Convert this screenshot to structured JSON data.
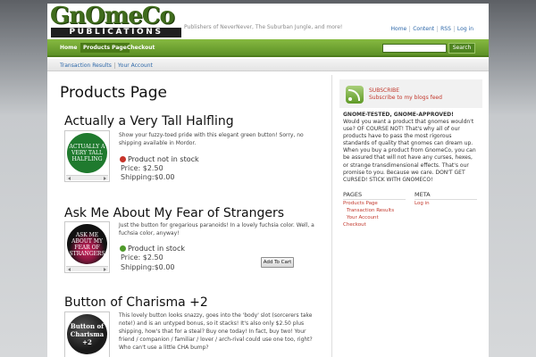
{
  "header": {
    "logo_text": "GnOmeCo",
    "logo_subtext": "PUBLICATIONS",
    "tagline": "Publishers of NeverNever, The Suburban Jungle, and more!",
    "links": [
      "Home",
      "Content",
      "RSS",
      "Log in"
    ]
  },
  "nav": {
    "items": [
      "Home",
      "Products Page",
      "Checkout"
    ],
    "active": "Products Page",
    "search_button": "Search",
    "search_value": ""
  },
  "subnav": {
    "items": [
      "Transaction Results",
      "Your Account"
    ]
  },
  "main": {
    "title": "Products Page",
    "products": [
      {
        "title": "Actually a Very Tall Halfling",
        "image_text": "ACTUALLY A VERY TALL HALFLING",
        "image_color": "#1f7a2e",
        "description": "Show your fuzzy-toed pride with this elegant green button! Sorry, no shipping available in Mordor.",
        "stock": "Product not in stock",
        "price": "Price: $2.50",
        "shipping": "Shipping:$0.00"
      },
      {
        "title": "Ask Me About My Fear of Strangers",
        "image_text": "ASK ME ABOUT MY FEAR OF STRANGERS",
        "image_color": "#111111",
        "description": "Just the button for gregarious paranoids! In a lovely fuchsia color. Well, a fuchsia color, anyway!",
        "stock": "Product in stock",
        "price": "Price: $2.50",
        "shipping": "Shipping:$0.00",
        "cart_button": "Add To Cart"
      },
      {
        "title": "Button of Charisma +2",
        "image_text": "Button of Charisma +2",
        "image_color": "#1a1a1a",
        "description": "This lovely button looks snazzy, goes into the 'body' slot (sorcerers take note!) and is an untyped bonus, so it stacks! It's also only $2.50 plus shipping, how's that for a steal? Buy one today! In fact, buy two! Your friend / companion / familiar / lover / arch-rival could use one too, right? Who can't use a little CHA bump?"
      }
    ]
  },
  "sidebar": {
    "subscribe_title": "SUBSCRIBE",
    "subscribe_link": "Subscribe to my blogs feed",
    "heading": "GNOME-TESTED, GNOME-APPROVED!",
    "text": "Would you want a product that gnomes wouldn't use? OF COURSE NOT! That's why all of our products have to pass the most rigorous standards of quality that gnomes can dream up. When you buy a product from GnomeCo, you can be assured that will not have any curses, hexes, or strange transdimensional effects. That's our promise to you. Because we care. DON'T GET CURSED! STICK WITH GNOMECO!",
    "pages_title": "PAGES",
    "pages": [
      "Products Page",
      "Transaction Results",
      "Your Account",
      "Checkout"
    ],
    "meta_title": "META",
    "meta": [
      "Log in"
    ]
  },
  "colors": {
    "nav_green": "#5d9126",
    "link_red": "#c2372b",
    "link_blue": "#2b66a8"
  }
}
